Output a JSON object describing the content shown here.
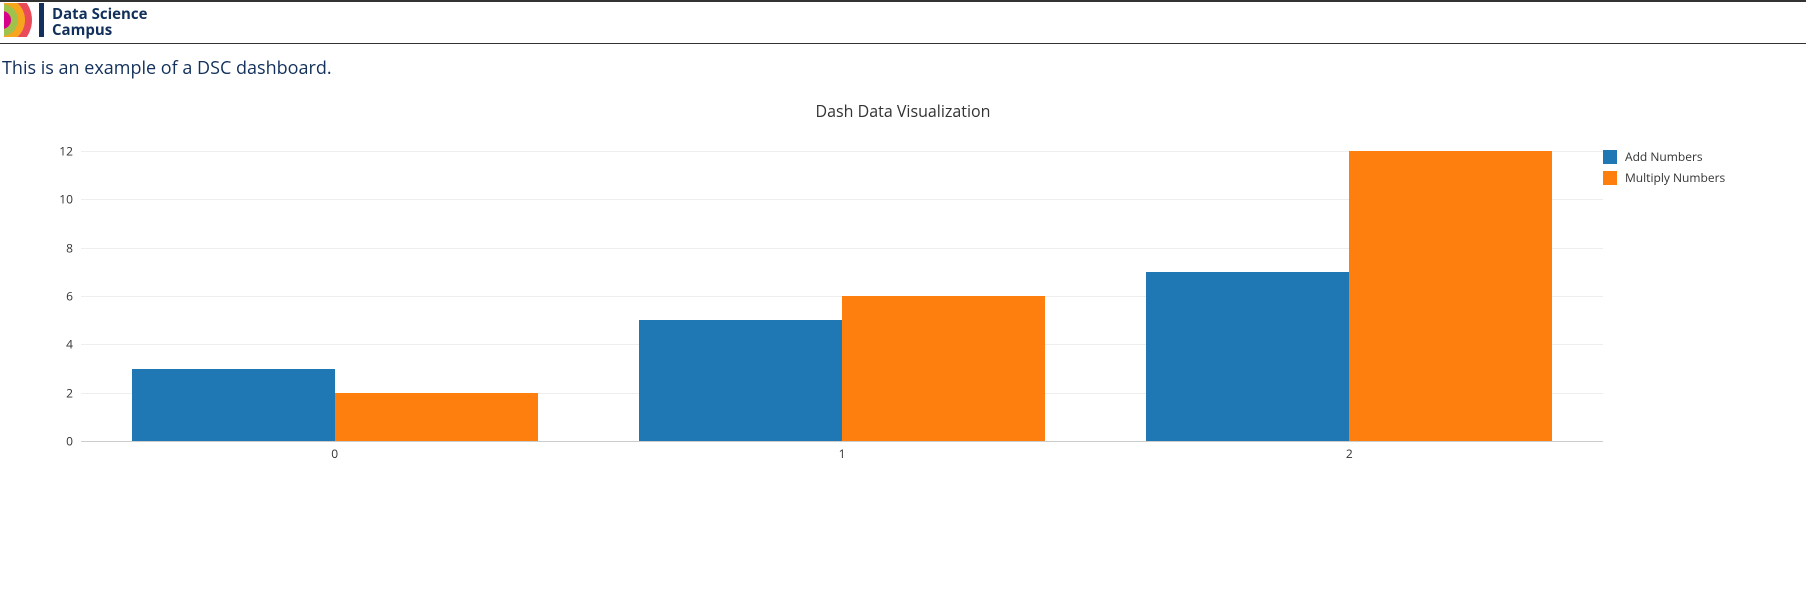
{
  "brand": {
    "line1": "Data Science",
    "line2": "Campus"
  },
  "description": "This is an example of a DSC dashboard.",
  "chart_data": {
    "type": "bar",
    "title": "Dash Data Visualization",
    "categories": [
      "0",
      "1",
      "2"
    ],
    "series": [
      {
        "name": "Add Numbers",
        "color": "#1f77b4",
        "values": [
          3,
          5,
          7
        ]
      },
      {
        "name": "Multiply Numbers",
        "color": "#ff7f0e",
        "values": [
          2,
          6,
          12
        ]
      }
    ],
    "xlabel": "",
    "ylabel": "",
    "ylim": [
      0,
      12
    ],
    "y_ticks": [
      0,
      2,
      4,
      6,
      8,
      10,
      12
    ]
  }
}
